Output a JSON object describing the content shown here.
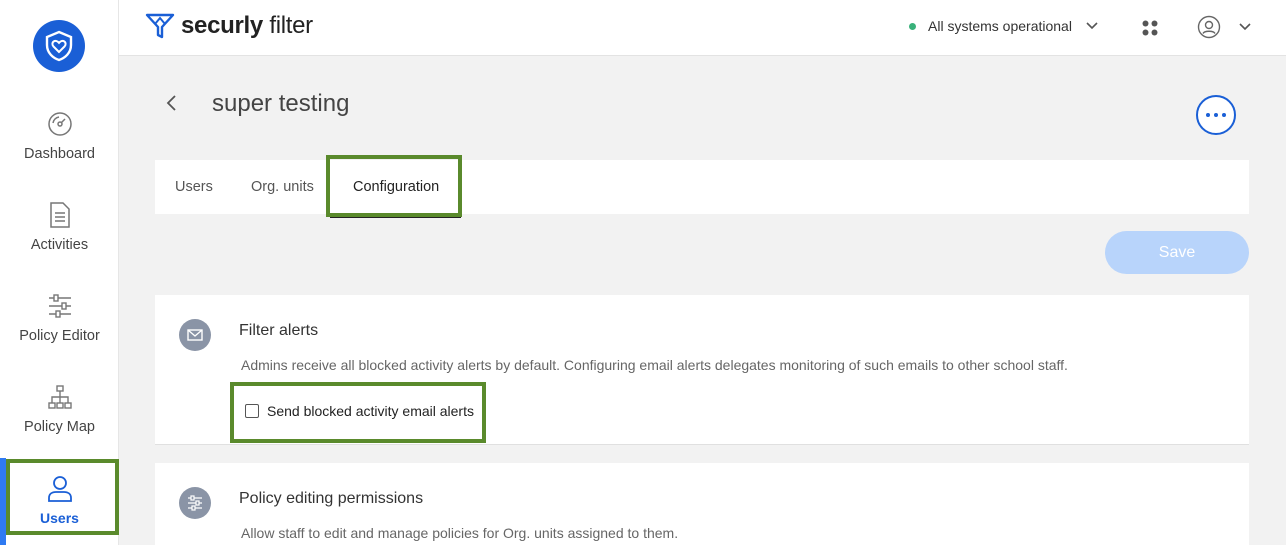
{
  "colors": {
    "brand_blue": "#1a5fd6",
    "status_green": "#39b17a",
    "highlight_green": "#5a8a2c",
    "save_disabled": "#b8d4fb"
  },
  "header": {
    "brand_bold": "securly",
    "brand_light": " filter",
    "status_text": "All systems operational"
  },
  "sidebar": {
    "items": [
      {
        "label": "Dashboard",
        "icon": "dashboard-gauge-icon"
      },
      {
        "label": "Activities",
        "icon": "document-icon"
      },
      {
        "label": "Policy Editor",
        "icon": "sliders-icon"
      },
      {
        "label": "Policy Map",
        "icon": "hierarchy-icon"
      },
      {
        "label": "Users",
        "icon": "user-icon",
        "active": true
      }
    ]
  },
  "page": {
    "title": "super testing"
  },
  "tabs": [
    {
      "label": "Users"
    },
    {
      "label": "Org. units"
    },
    {
      "label": "Configuration",
      "active": true
    }
  ],
  "save_label": "Save",
  "filter_alerts": {
    "title": "Filter alerts",
    "description": "Admins receive all blocked activity alerts by default. Configuring email alerts delegates monitoring of such emails to other school staff.",
    "checkbox_label": "Send blocked activity email alerts",
    "checked": false
  },
  "policy_permissions": {
    "title": "Policy editing permissions",
    "description": "Allow staff to edit and manage policies for Org. units assigned to them."
  }
}
